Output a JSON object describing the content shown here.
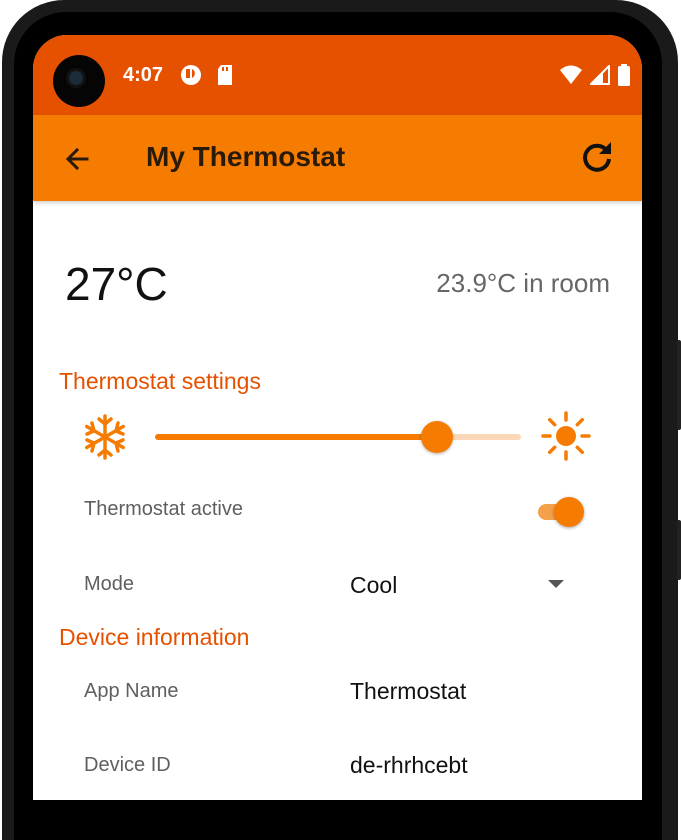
{
  "status_bar": {
    "time": "4:07",
    "icons": [
      "camera-cutout",
      "notification-icon",
      "sd-card-icon",
      "wifi-icon",
      "cell-signal-icon",
      "battery-icon"
    ]
  },
  "app_bar": {
    "title": "My Thermostat",
    "back_icon": "arrow-left-icon",
    "refresh_icon": "refresh-icon"
  },
  "temperature": {
    "setpoint": "27°C",
    "room": "23.9°C in room"
  },
  "thermostat_settings": {
    "heading": "Thermostat settings",
    "slider": {
      "min_icon": "snowflake-icon",
      "max_icon": "sun-icon",
      "value_fraction": 0.77
    },
    "active_label": "Thermostat active",
    "active": true,
    "mode_label": "Mode",
    "mode_value": "Cool"
  },
  "device_information": {
    "heading": "Device information",
    "rows": [
      {
        "label": "App Name",
        "value": "Thermostat"
      },
      {
        "label": "Device ID",
        "value": "de-rhrhcebt"
      }
    ]
  },
  "colors": {
    "status_bar": "#e65100",
    "app_bar": "#f57c00",
    "accent": "#e65100",
    "slider_track": "#fad8b8"
  }
}
